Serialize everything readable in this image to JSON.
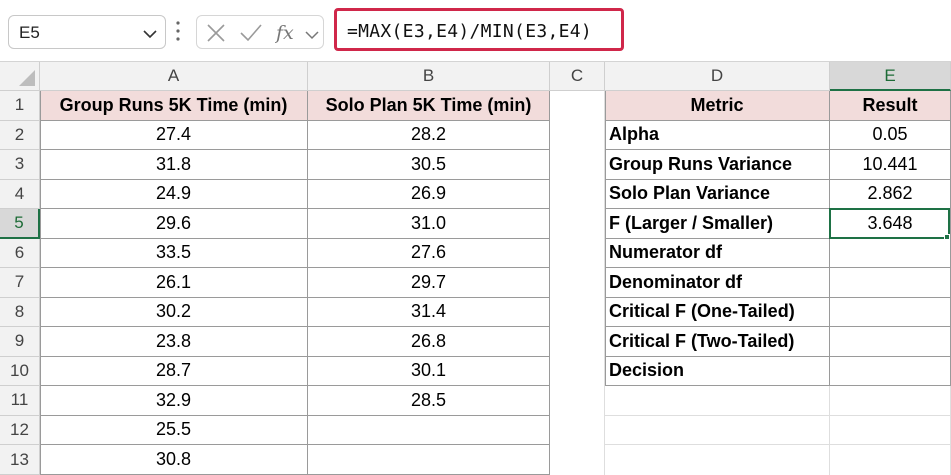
{
  "formula_bar": {
    "name_box": "E5",
    "formula": "=MAX(E3,E4)/MIN(E3,E4)",
    "icons": [
      "chevron-down-icon",
      "more-vert-icon",
      "cancel-x-icon",
      "check-icon",
      "fx-icon",
      "chevron-down-icon"
    ]
  },
  "columns": [
    "A",
    "B",
    "C",
    "D",
    "E"
  ],
  "rows": [
    "1",
    "2",
    "3",
    "4",
    "5",
    "6",
    "7",
    "8",
    "9",
    "10",
    "11",
    "12",
    "13"
  ],
  "selected": {
    "cell": "E5",
    "column": "E",
    "row": "5"
  },
  "colors": {
    "header_fill": "#f2dcdb",
    "selection": "#1e7145",
    "formula_highlight": "#d0274a"
  },
  "table_left": {
    "headers": [
      "Group Runs 5K Time (min)",
      "Solo Plan 5K Time (min)"
    ],
    "group_runs": [
      "27.4",
      "31.8",
      "24.9",
      "29.6",
      "33.5",
      "26.1",
      "30.2",
      "23.8",
      "28.7",
      "32.9",
      "25.5",
      "30.8"
    ],
    "solo_plan": [
      "28.2",
      "30.5",
      "26.9",
      "31.0",
      "27.6",
      "29.7",
      "31.4",
      "26.8",
      "30.1",
      "28.5"
    ]
  },
  "table_right": {
    "headers": [
      "Metric",
      "Result"
    ],
    "metrics": [
      "Alpha",
      "Group Runs Variance",
      "Solo Plan Variance",
      "F (Larger / Smaller)",
      "Numerator df",
      "Denominator df",
      "Critical F (One-Tailed)",
      "Critical F (Two-Tailed)",
      "Decision"
    ],
    "results": [
      "0.05",
      "10.441",
      "2.862",
      "3.648",
      "",
      "",
      "",
      "",
      ""
    ]
  }
}
